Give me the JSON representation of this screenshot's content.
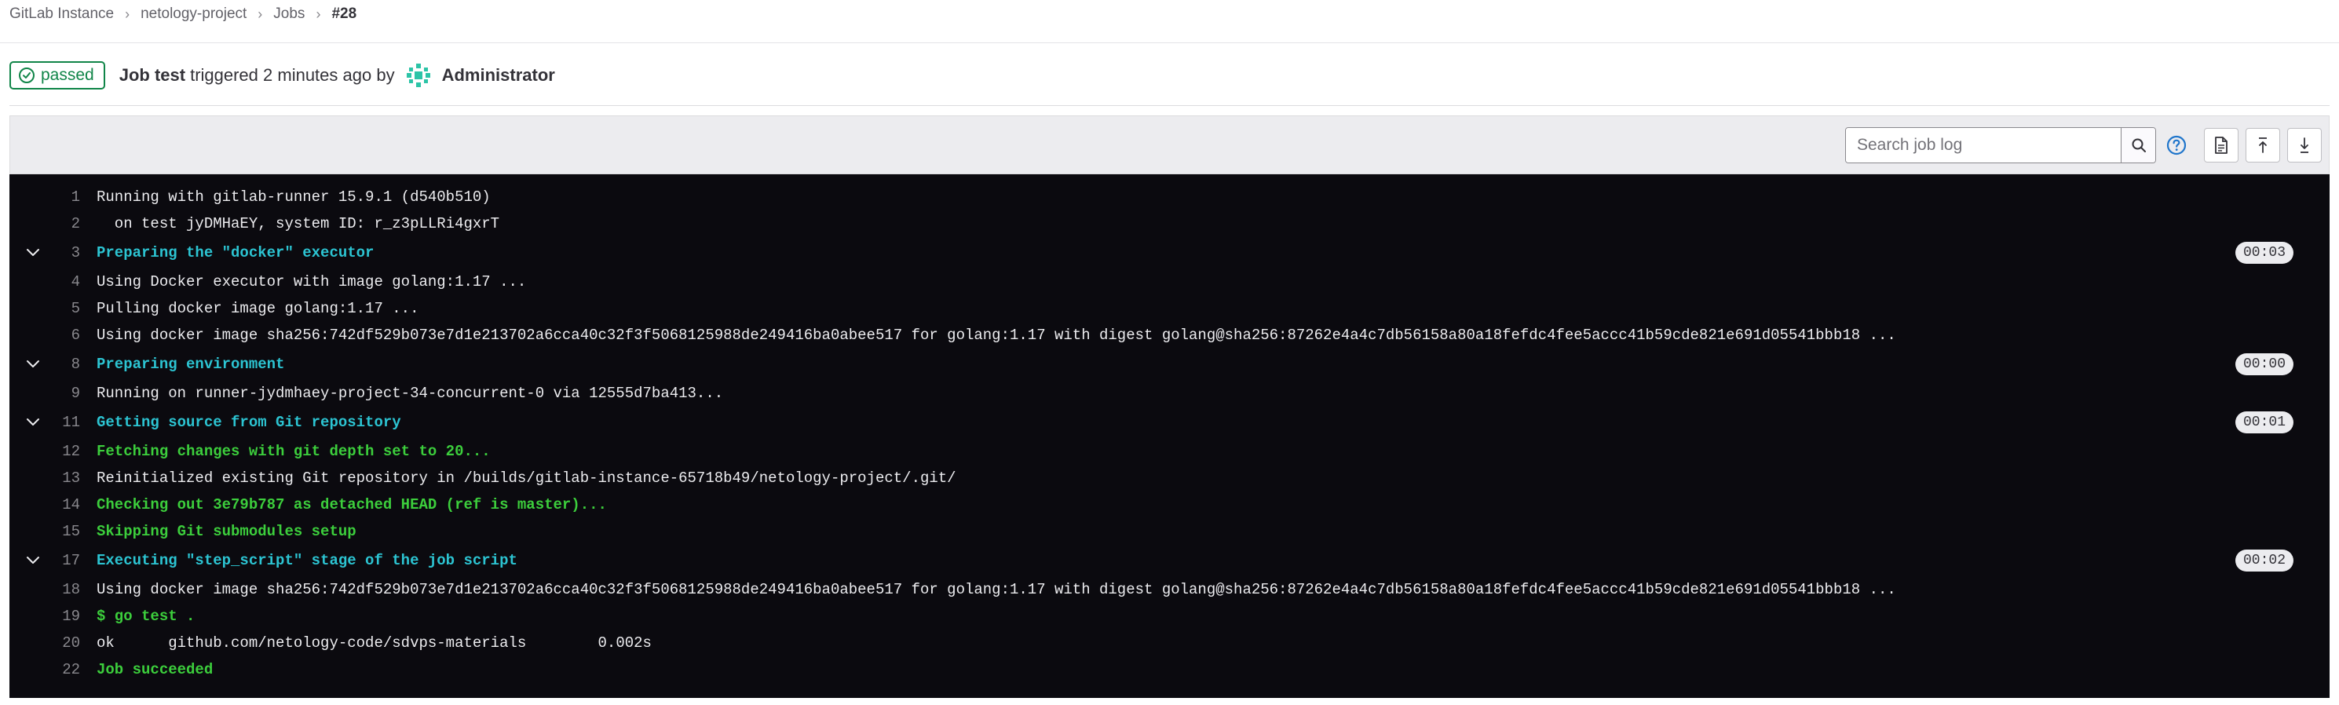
{
  "breadcrumb": {
    "items": [
      "GitLab Instance",
      "netology-project",
      "Jobs"
    ],
    "current": "#28"
  },
  "header": {
    "status": "passed",
    "job_label": "Job test",
    "triggered_text": "triggered 2 minutes ago by",
    "user": "Administrator"
  },
  "toolbar": {
    "search_placeholder": "Search job log"
  },
  "colors": {
    "success": "#108548",
    "log_bg": "#0b0a0f",
    "log_section": "#2cc4d2",
    "log_success": "#3cce3c"
  },
  "log": [
    {
      "n": "1",
      "text": "Running with gitlab-runner 15.9.1 (d540b510)",
      "style": "plain"
    },
    {
      "n": "2",
      "text": "  on test jyDMHaEY, system ID: r_z3pLLRi4gxrT",
      "style": "plain"
    },
    {
      "n": "3",
      "text": "Preparing the \"docker\" executor",
      "style": "section",
      "duration": "00:03"
    },
    {
      "n": "4",
      "text": "Using Docker executor with image golang:1.17 ...",
      "style": "plain"
    },
    {
      "n": "5",
      "text": "Pulling docker image golang:1.17 ...",
      "style": "plain"
    },
    {
      "n": "6",
      "text": "Using docker image sha256:742df529b073e7d1e213702a6cca40c32f3f5068125988de249416ba0abee517 for golang:1.17 with digest golang@sha256:87262e4a4c7db56158a80a18fefdc4fee5accc41b59cde821e691d05541bbb18 ...",
      "style": "plain"
    },
    {
      "n": "8",
      "text": "Preparing environment",
      "style": "section",
      "duration": "00:00"
    },
    {
      "n": "9",
      "text": "Running on runner-jydmhaey-project-34-concurrent-0 via 12555d7ba413...",
      "style": "plain"
    },
    {
      "n": "11",
      "text": "Getting source from Git repository",
      "style": "section",
      "duration": "00:01"
    },
    {
      "n": "12",
      "text": "Fetching changes with git depth set to 20...",
      "style": "green"
    },
    {
      "n": "13",
      "text": "Reinitialized existing Git repository in /builds/gitlab-instance-65718b49/netology-project/.git/",
      "style": "plain"
    },
    {
      "n": "14",
      "text": "Checking out 3e79b787 as detached HEAD (ref is master)...",
      "style": "green"
    },
    {
      "n": "15",
      "text": "Skipping Git submodules setup",
      "style": "green"
    },
    {
      "n": "17",
      "text": "Executing \"step_script\" stage of the job script",
      "style": "section",
      "duration": "00:02"
    },
    {
      "n": "18",
      "text": "Using docker image sha256:742df529b073e7d1e213702a6cca40c32f3f5068125988de249416ba0abee517 for golang:1.17 with digest golang@sha256:87262e4a4c7db56158a80a18fefdc4fee5accc41b59cde821e691d05541bbb18 ...",
      "style": "plain"
    },
    {
      "n": "19",
      "text": "$ go test .",
      "style": "green"
    },
    {
      "n": "20",
      "text": "ok  \tgithub.com/netology-code/sdvps-materials\t0.002s",
      "style": "plain"
    },
    {
      "n": "22",
      "text": "Job succeeded",
      "style": "green"
    }
  ]
}
